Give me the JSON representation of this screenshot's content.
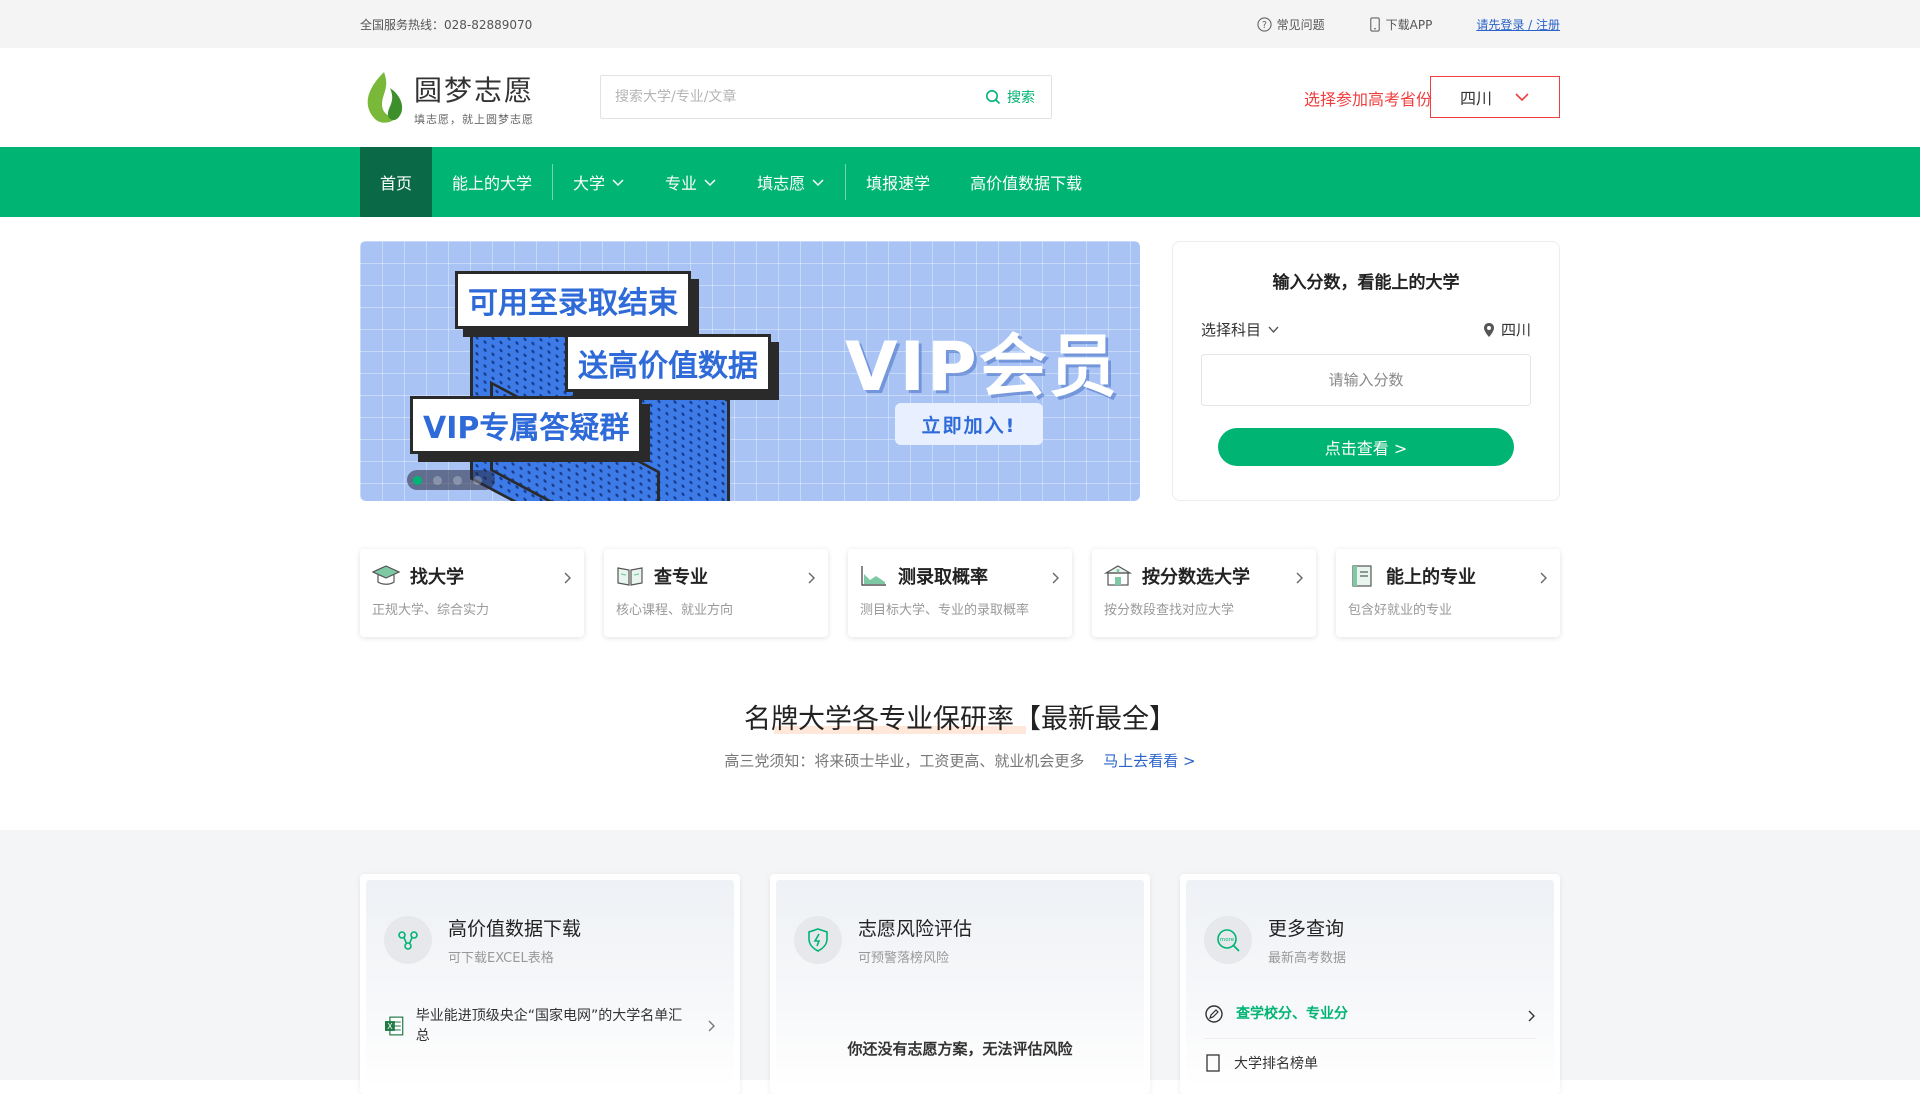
{
  "topbar": {
    "hotline": "全国服务热线：028-82889070",
    "faq": "常见问题",
    "download_app": "下载APP",
    "login": "请先登录 / 注册"
  },
  "header": {
    "logo_title": "圆梦志愿",
    "logo_slogan": "填志愿，就上圆梦志愿",
    "search_placeholder": "搜索大学/专业/文章",
    "search_button": "搜索",
    "province_label": "选择参加高考省份",
    "province_value": "四川"
  },
  "nav": {
    "items": [
      "首页",
      "能上的大学",
      "大学",
      "专业",
      "填志愿",
      "填报速学",
      "高价值数据下载"
    ]
  },
  "banner": {
    "tag1": "可用至录取结束",
    "tag2": "送高价值数据",
    "tag3": "VIP专属答疑群",
    "headline": "VIP会员",
    "cta": "立即加入!"
  },
  "score_box": {
    "title": "输入分数，看能上的大学",
    "subject_select": "选择科目",
    "province": "四川",
    "score_placeholder": "请输入分数",
    "submit": "点击查看 >"
  },
  "quick_cards": [
    {
      "name": "找大学",
      "desc": "正规大学、综合实力"
    },
    {
      "name": "查专业",
      "desc": "核心课程、就业方向"
    },
    {
      "name": "测录取概率",
      "desc": "测目标大学、专业的录取概率"
    },
    {
      "name": "按分数选大学",
      "desc": "按分数段查找对应大学"
    },
    {
      "name": "能上的专业",
      "desc": "包含好就业的专业"
    }
  ],
  "promo": {
    "title": "名牌大学各专业保研率【最新最全】",
    "subtitle": "高三党须知：将来硕士毕业，工资更高、就业机会更多",
    "link": "马上去看看 >"
  },
  "bottom_cards": {
    "data_download": {
      "title": "高价值数据下载",
      "subtitle": "可下载EXCEL表格",
      "item1": "毕业能进顶级央企“国家电网”的大学名单汇总"
    },
    "risk": {
      "title": "志愿风险评估",
      "subtitle": "可预警落榜风险",
      "message": "你还没有志愿方案，无法评估风险"
    },
    "more": {
      "title": "更多查询",
      "subtitle": "最新高考数据",
      "item1": "查学校分、专业分",
      "item2": "大学排名榜单"
    }
  },
  "colors": {
    "brand_green": "#00b473",
    "nav_active": "#0a6a47",
    "alert_red": "#f03d3d",
    "link_blue": "#2a63c9"
  }
}
